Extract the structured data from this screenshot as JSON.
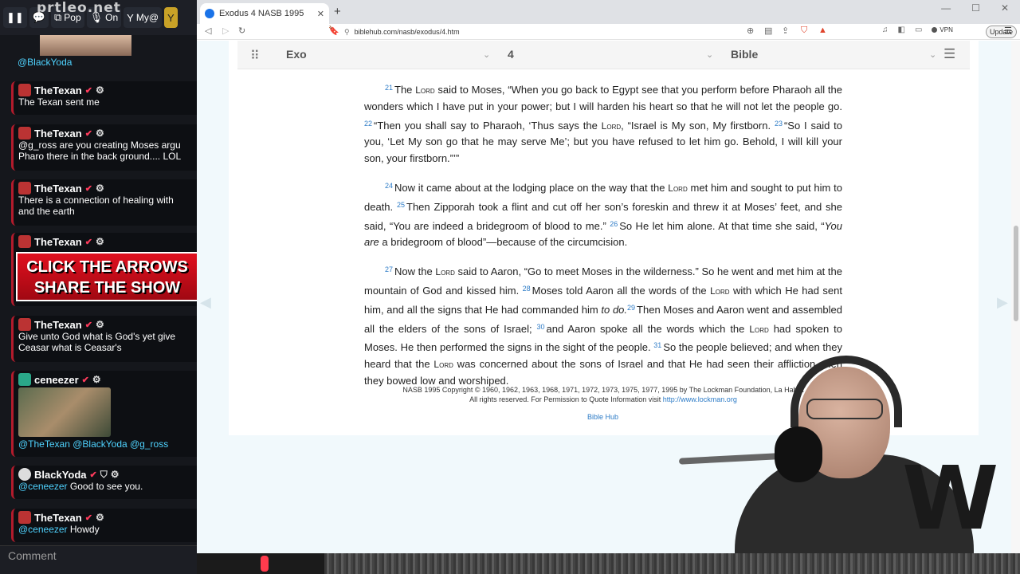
{
  "chat": {
    "logo": "prtleo.net",
    "toolbar": [
      {
        "icon": "pause-icon",
        "label": ""
      },
      {
        "icon": "chat-bubble-icon",
        "label": ""
      },
      {
        "icon": "popout-icon",
        "label": "Pop"
      },
      {
        "icon": "microphone-icon",
        "label": "On"
      },
      {
        "icon": "filter-icon",
        "label": "My@"
      },
      {
        "icon": "filter-icon",
        "label": ""
      }
    ],
    "top_mention": "@BlackYoda",
    "messages": [
      {
        "user": "TheTexan",
        "text": "The Texan sent me"
      },
      {
        "user": "TheTexan",
        "text": "@g_ross are you creating Moses argu",
        "text2": "Pharo there in the back ground.... LOL"
      },
      {
        "user": "TheTexan",
        "text": "There is a connection of healing with",
        "text2": "and the earth"
      },
      {
        "user": "TheTexan",
        "promo_line1": "CLICK THE ARROWS",
        "promo_line2": "SHARE THE SHOW"
      },
      {
        "user": "TheTexan",
        "text": "Give unto God what is God's yet give",
        "text2": "Ceasar what is Ceasar's"
      },
      {
        "user": "ceneezer",
        "text": "@TheTexan @BlackYoda @g_ross"
      },
      {
        "user": "BlackYoda",
        "mention": "@ceneezer",
        "text": "Good to see you."
      },
      {
        "user": "TheTexan",
        "mention": "@ceneezer",
        "text": "Howdy"
      }
    ],
    "comment_placeholder": "Comment"
  },
  "browser": {
    "tab_title": "Exodus 4 NASB 1995",
    "url": "biblehub.com/nasb/exodus/4.htm",
    "vpn_label": "VPN",
    "update_label": "Update",
    "nav": {
      "book": "Exo",
      "chapter": "4",
      "version": "Bible"
    },
    "verses": {
      "p1": [
        {
          "n": "21",
          "t": "The "
        },
        {
          "sc": "Lord"
        },
        {
          "t": " said to Moses, “When you go back to Egypt see that you perform before Pharaoh all the wonders which I have put in your power; but I will harden his heart so that he will not let the people go. "
        },
        {
          "n": "22",
          "t": "“Then you shall say to Pharaoh, ‘Thus says the "
        },
        {
          "sc": "Lord"
        },
        {
          "t": ", “Israel is My son, My firstborn. "
        },
        {
          "n": "23",
          "t": "“So I said to you, ‘Let My son go that he may serve Me’; but you have refused to let him go. Behold, I will kill your son, your firstborn.”’”"
        }
      ],
      "p2": [
        {
          "n": "24",
          "t": "Now it came about at the lodging place on the way that the "
        },
        {
          "sc": "Lord"
        },
        {
          "t": " met him and sought to put him to death. "
        },
        {
          "n": "25",
          "t": "Then Zipporah took a flint and cut off her son’s foreskin and threw it at Moses’ feet, and she said, “You are indeed a bridegroom of blood to me.” "
        },
        {
          "n": "26",
          "t": "So He let him alone. At that time she said, “"
        },
        {
          "i": "You are"
        },
        {
          "t": " a bridegroom of blood”—because of the circumcision."
        }
      ],
      "p3": [
        {
          "n": "27",
          "t": "Now the "
        },
        {
          "sc": "Lord"
        },
        {
          "t": " said to Aaron, “Go to meet Moses in the wilderness.” So he went and met him at the mountain of God and kissed him. "
        },
        {
          "n": "28",
          "t": "Moses told Aaron all the words of the "
        },
        {
          "sc": "Lord"
        },
        {
          "t": " with which He had sent him, and all the signs that He had commanded him "
        },
        {
          "i": "to do."
        },
        {
          "n": "29",
          "t": "Then Moses and Aaron went and assembled all the elders of the sons of Israel; "
        },
        {
          "n": "30",
          "t": "and Aaron spoke all the words which the "
        },
        {
          "sc": "Lord"
        },
        {
          "t": " had spoken to Moses. He then performed the signs in the sight of the people. "
        },
        {
          "n": "31",
          "t": "So the people believed; and when they heard that the "
        },
        {
          "sc": "Lord"
        },
        {
          "t": " was concerned about the sons of Israel and that He had seen their affliction, then they bowed low and worshiped."
        }
      ]
    },
    "copyright_line1": "NASB 1995 Copyright © 1960, 1962, 1963, 1968, 1971, 1972, 1973, 1975, 1977, 1995 by The Lockman Foundation, La Habra",
    "copyright_line2": "All rights reserved. For Permission to Quote Information visit",
    "copyright_link": "http://www.lockman.org",
    "footer_link": "Bible Hub"
  },
  "colors": {
    "accent": "#2e7cc7",
    "chat_border": "#b31b2c",
    "promo_red": "#e1101f"
  }
}
